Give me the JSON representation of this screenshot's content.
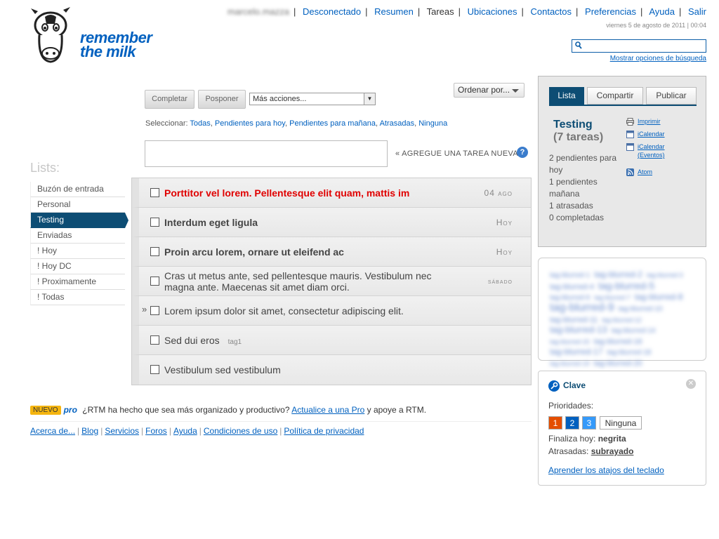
{
  "brand": {
    "line1": "remember",
    "line2": "the milk"
  },
  "topnav": {
    "user": "marcelo.mazza",
    "items": [
      {
        "label": "Desconectado"
      },
      {
        "label": "Resumen"
      },
      {
        "label": "Tareas"
      },
      {
        "label": "Ubicaciones"
      },
      {
        "label": "Contactos"
      },
      {
        "label": "Preferencias"
      },
      {
        "label": "Ayuda"
      },
      {
        "label": "Salir"
      }
    ],
    "datetime": "viernes 5 de agosto de 2011 | 00:04"
  },
  "search": {
    "value": "",
    "placeholder": "",
    "options_link": "Mostrar opciones de búsqueda"
  },
  "lists": {
    "title": "Lists:",
    "items": [
      {
        "label": "Buzón de entrada"
      },
      {
        "label": "Personal"
      },
      {
        "label": "Testing",
        "active": true
      },
      {
        "label": "Enviadas"
      },
      {
        "label": "! Hoy"
      },
      {
        "label": "! Hoy DC"
      },
      {
        "label": "! Proximamente"
      },
      {
        "label": "! Todas"
      }
    ]
  },
  "toolbar": {
    "complete": "Completar",
    "postpone": "Posponer",
    "more_actions": "Más acciones...",
    "sort": "Ordenar por..."
  },
  "select_row": {
    "prefix": "Seleccionar:",
    "links": [
      "Todas",
      "Pendientes para hoy",
      "Pendientes para mañana",
      "Atrasadas",
      "Ninguna"
    ]
  },
  "add_task": {
    "value": "",
    "label": "« AGREGUE UNA TAREA NUEVA",
    "help": "?"
  },
  "tasks": [
    {
      "name": "Porttitor vel lorem. Pellentesque elit quam, mattis im",
      "due": "04 ago",
      "priority": "1"
    },
    {
      "name": "Interdum eget ligula",
      "due": "Hoy",
      "priority": "bold"
    },
    {
      "name": "Proin arcu lorem, ornare ut eleifend ac",
      "due": "Hoy",
      "priority": "bold"
    },
    {
      "name": "Cras ut metus ante, sed pellentesque mauris. Vestibulum nec magna ante. Maecenas sit amet diam orci.",
      "due": "sábado",
      "priority": "none"
    },
    {
      "name": "Lorem ipsum dolor sit amet, consectetur adipiscing elit.",
      "due": "",
      "marker": "»",
      "priority": "none"
    },
    {
      "name": "Sed dui eros",
      "tag": "tag1",
      "due": "",
      "priority": "none"
    },
    {
      "name": "Vestibulum sed vestibulum",
      "due": "",
      "priority": "none"
    }
  ],
  "upgrade": {
    "badge": "NUEVO",
    "pro": "pro",
    "text_before": "¿RTM ha hecho que sea más organizado y productivo?",
    "link": "Actualice a una Pro",
    "text_after": "y apoye a RTM."
  },
  "footer": {
    "links": [
      "Acerca de...",
      "Blog",
      "Servicios",
      "Foros",
      "Ayuda",
      "Condiciones de uso",
      "Política de privacidad"
    ]
  },
  "list_panel": {
    "tabs": {
      "list": "Lista",
      "share": "Compartir",
      "publish": "Publicar"
    },
    "list_name": "Testing",
    "count": "(7 tareas)",
    "stats": [
      "2 pendientes para hoy",
      "1 pendientes mañana",
      "1 atrasadas",
      "0 completadas"
    ],
    "links": [
      {
        "label": "Imprimir",
        "icon": "printer-icon"
      },
      {
        "label": "iCalendar",
        "icon": "calendar-icon"
      },
      {
        "label": "iCalendar (Eventos)",
        "icon": "calendar-icon"
      },
      {
        "label": "Atom",
        "icon": "feed-icon"
      }
    ]
  },
  "tag_cloud": {
    "tags": [
      "tag-blurred-1",
      "tag-blurred-2",
      "tag-blurred-3",
      "tag-blurred-4",
      "tag-blurred-5",
      "tag-blurred-6",
      "tag-blurred-7",
      "tag-blurred-8",
      "tag-blurred-9",
      "tag-blurred-10",
      "tag-blurred-11",
      "tag-blurred-12",
      "tag-blurred-13",
      "tag-blurred-14",
      "tag-blurred-15",
      "tag-blurred-16",
      "tag-blurred-17",
      "tag-blurred-18",
      "tag-blurred-19",
      "tag-blurred-20"
    ]
  },
  "key_panel": {
    "title": "Clave",
    "priorities_label": "Prioridades:",
    "p1": "1",
    "p2": "2",
    "p3": "3",
    "none": "Ninguna",
    "due_today_label": "Finaliza hoy:",
    "due_today_value": "negrita",
    "overdue_label": "Atrasadas:",
    "overdue_value": "subrayado",
    "shortcuts_link": "Aprender los atajos del teclado"
  },
  "colors": {
    "brand_blue": "#0060bf",
    "dark_blue": "#0d4d74",
    "priority1": "#e44e00",
    "priority2": "#0060bf",
    "priority3": "#359afa",
    "overdue_red": "#e00000"
  }
}
